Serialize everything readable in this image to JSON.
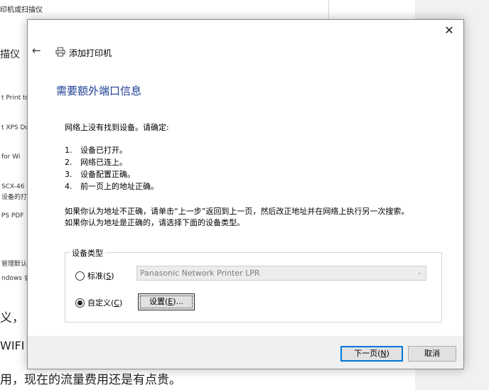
{
  "background": {
    "title": "印机或扫描仪",
    "heading": "描仪",
    "printers": [
      "t Print to",
      "t XPS Do",
      "for Wi",
      "SCX-46",
      "设备的打",
      "PS PDF",
      "管理默认",
      "ndows 会"
    ],
    "doc_lines": [
      "义，",
      "WIFI",
      "用，现在的流量费用还是有点贵。"
    ]
  },
  "dialog": {
    "close_glyph": "✕",
    "back_glyph": "←",
    "title": "添加打印机",
    "heading": "需要额外端口信息",
    "intro": "网络上没有找到设备。请确定:",
    "checklist": [
      {
        "num": "1.",
        "text": "设备已打开。"
      },
      {
        "num": "2.",
        "text": "网络已连上。"
      },
      {
        "num": "3.",
        "text": "设备配置正确。"
      },
      {
        "num": "4.",
        "text": "前一页上的地址正确。"
      }
    ],
    "paragraph_line1": "如果你认为地址不正确，请单击“上一步”返回到上一页，然后改正地址并在网络上执行另一次搜索。",
    "paragraph_line2": "如果你认为地址是正确的，请选择下面的设备类型。",
    "device_type": {
      "legend": "设备类型",
      "standard_label": "标准(",
      "standard_key": "S",
      "standard_end": ")",
      "standard_selected": false,
      "combo_value": "Panasonic Network Printer LPR",
      "custom_label": "自定义(",
      "custom_key": "C",
      "custom_end": ")",
      "custom_selected": true,
      "settings_label": "设置(",
      "settings_key": "E",
      "settings_end": ")..."
    },
    "buttons": {
      "next_label": "下一页(",
      "next_key": "N",
      "next_end": ")",
      "cancel": "取消"
    }
  },
  "colors": {
    "heading": "#1c3e94",
    "primary_border": "#0078d7"
  }
}
